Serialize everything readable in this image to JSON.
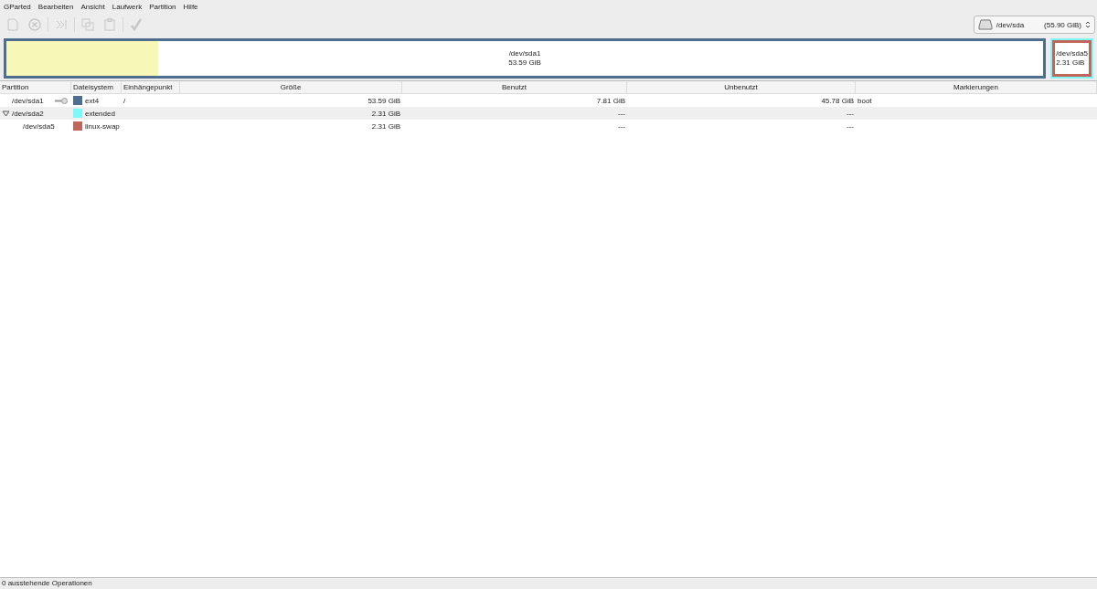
{
  "menu": [
    "GParted",
    "Bearbeiten",
    "Ansicht",
    "Laufwerk",
    "Partition",
    "Hilfe"
  ],
  "toolbar": [
    {
      "kind": "new",
      "disabled": true
    },
    {
      "kind": "delete",
      "disabled": true
    },
    {
      "kind": "sep"
    },
    {
      "kind": "resize",
      "disabled": true
    },
    {
      "kind": "sep"
    },
    {
      "kind": "copy",
      "disabled": true
    },
    {
      "kind": "paste",
      "disabled": true
    },
    {
      "kind": "sep"
    },
    {
      "kind": "apply",
      "disabled": true
    }
  ],
  "device": {
    "name": "/dev/sda",
    "size": "(55.90 GiB)"
  },
  "disk_map": [
    {
      "kind": "primary",
      "name": "/dev/sda1",
      "size": "53.59 GiB",
      "level": 0.146,
      "color": "#4f6e8f"
    },
    {
      "kind": "extended",
      "color": "#7ef9f9",
      "children": [
        {
          "name": "/dev/sda5",
          "size": "2.31 GiB",
          "color": "#c1665a"
        }
      ]
    }
  ],
  "table": {
    "columns": [
      "Partition",
      "Dateisystem",
      "Einhängepunkt",
      "Größe",
      "Benutzt",
      "Unbenutzt",
      "Markierungen"
    ],
    "rows": [
      {
        "partition": "/dev/sda1",
        "mounted": true,
        "filesystem": "ext4",
        "color": "#4f6e8f",
        "mount_point": "/",
        "size": "53.59 GiB",
        "used": "7.81 GiB",
        "unused": "45.78 GiB",
        "flags": "boot"
      },
      {
        "partition": "/dev/sda2",
        "mounted": false,
        "expanded": true,
        "filesystem": "extended",
        "color": "#7ef9f9",
        "size": "2.31 GiB",
        "used": "---",
        "unused": "---",
        "children": [
          {
            "partition": "/dev/sda5",
            "mounted": false,
            "filesystem": "linux-swap",
            "color": "#c1665a",
            "size": "2.31 GiB",
            "used": "---",
            "unused": "---"
          }
        ]
      }
    ]
  },
  "status_bar": "0 ausstehende Operationen"
}
